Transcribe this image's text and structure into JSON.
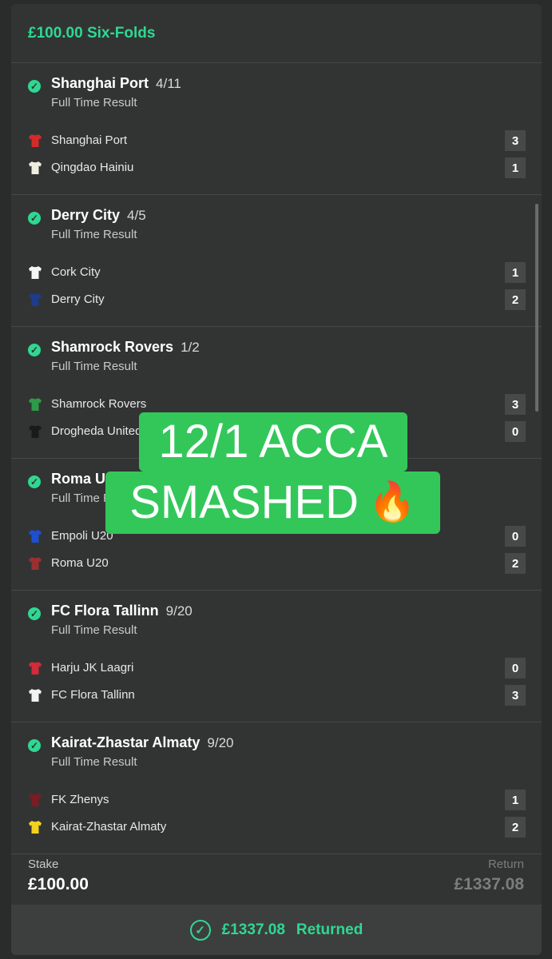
{
  "header": {
    "title": "£100.00 Six-Folds"
  },
  "selections": [
    {
      "name": "Shanghai Port",
      "odds": "4/11",
      "market": "Full Time Result",
      "teams": [
        {
          "name": "Shanghai Port",
          "score": "3",
          "shirt_color": "#d42a2a"
        },
        {
          "name": "Qingdao Hainiu",
          "score": "1",
          "shirt_color": "#f0eee0"
        }
      ]
    },
    {
      "name": "Derry City",
      "odds": "4/5",
      "market": "Full Time Result",
      "teams": [
        {
          "name": "Cork City",
          "score": "1",
          "shirt_color": "#f5f5f5"
        },
        {
          "name": "Derry City",
          "score": "2",
          "shirt_color": "#1f3b8c"
        }
      ]
    },
    {
      "name": "Shamrock Rovers",
      "odds": "1/2",
      "market": "Full Time Result",
      "teams": [
        {
          "name": "Shamrock Rovers",
          "score": "3",
          "shirt_color": "#2e9a4a"
        },
        {
          "name": "Drogheda United",
          "score": "0",
          "shirt_color": "#1a1a1a"
        }
      ]
    },
    {
      "name": "Roma U20",
      "odds": "",
      "market": "Full Time Result",
      "teams": [
        {
          "name": "Empoli U20",
          "score": "0",
          "shirt_color": "#1d4fd1"
        },
        {
          "name": "Roma U20",
          "score": "2",
          "shirt_color": "#9c2f2f"
        }
      ]
    },
    {
      "name": "FC Flora Tallinn",
      "odds": "9/20",
      "market": "Full Time Result",
      "teams": [
        {
          "name": "Harju JK Laagri",
          "score": "0",
          "shirt_color": "#d42a3a"
        },
        {
          "name": "FC Flora Tallinn",
          "score": "3",
          "shirt_color": "#f2f2f2"
        }
      ]
    },
    {
      "name": "Kairat-Zhastar Almaty",
      "odds": "9/20",
      "market": "Full Time Result",
      "teams": [
        {
          "name": "FK Zhenys",
          "score": "1",
          "shirt_color": "#7a1c24"
        },
        {
          "name": "Kairat-Zhastar Almaty",
          "score": "2",
          "shirt_color": "#f2d21f"
        }
      ]
    }
  ],
  "stake": {
    "label": "Stake",
    "value": "£100.00"
  },
  "return": {
    "label": "Return",
    "value": "£1337.08"
  },
  "returned_bar": {
    "amount": "£1337.08",
    "label": "Returned"
  },
  "overlay": {
    "line1": "12/1 ACCA",
    "line2": "SMASHED",
    "emoji": "🔥"
  },
  "colors": {
    "accent": "#2fd892",
    "card": "#323434",
    "overlay": "#33c75a"
  }
}
